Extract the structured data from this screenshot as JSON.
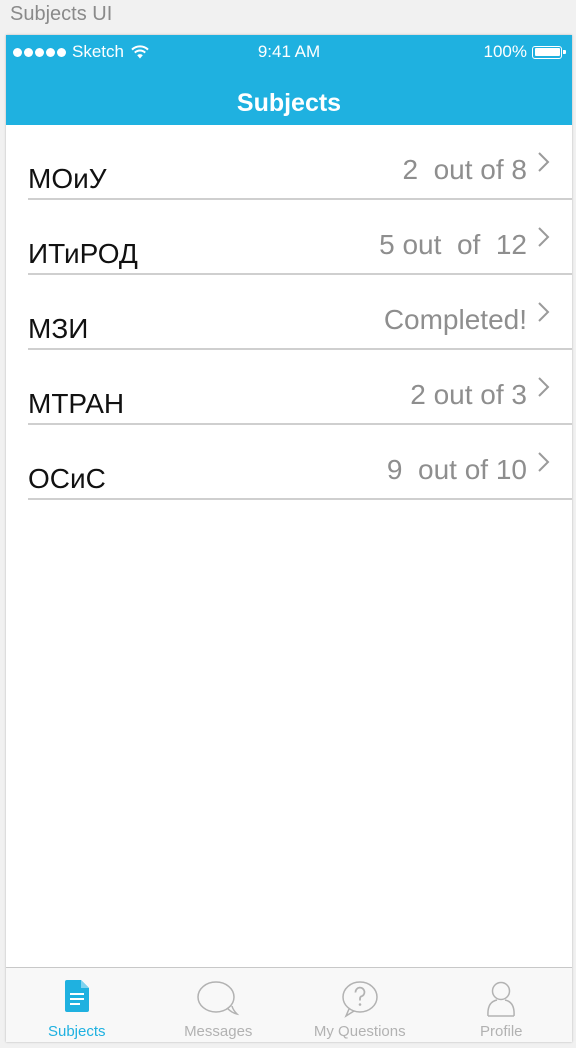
{
  "artboard": {
    "title": "Subjects UI"
  },
  "status_bar": {
    "carrier": "Sketch",
    "time": "9:41 AM",
    "battery": "100%"
  },
  "nav": {
    "title": "Subjects"
  },
  "subjects": [
    {
      "name": "МОиУ",
      "progress": "2  out of 8"
    },
    {
      "name": "ИТиРОД",
      "progress": "5 out  of  12"
    },
    {
      "name": "МЗИ",
      "progress": "Completed!"
    },
    {
      "name": "МТРАН",
      "progress": "2 out of 3"
    },
    {
      "name": "ОСиС",
      "progress": "9  out of 10"
    }
  ],
  "tabs": [
    {
      "label": "Subjects",
      "icon": "document-icon",
      "active": true
    },
    {
      "label": "Messages",
      "icon": "chat-bubble-icon",
      "active": false
    },
    {
      "label": "My Questions",
      "icon": "question-bubble-icon",
      "active": false
    },
    {
      "label": "Profile",
      "icon": "person-icon",
      "active": false
    }
  ],
  "colors": {
    "accent": "#1fb1e0",
    "secondary_text": "#8e8e8e",
    "inactive_tab": "#b2b2b2"
  }
}
